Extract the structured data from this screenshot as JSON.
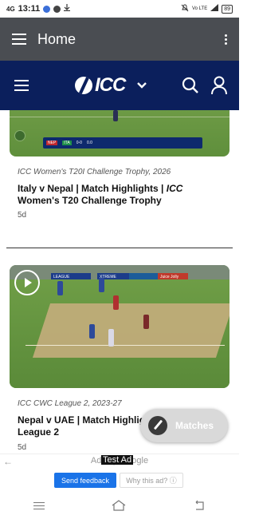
{
  "status_bar": {
    "network": "4G",
    "time": "13:11",
    "network_right": "Vo LTE",
    "battery": "89"
  },
  "app_bar": {
    "title": "Home",
    "menu_icon": "hamburger-icon",
    "overflow_icon": "more-vert-icon"
  },
  "site_header": {
    "logo_text": "ICC",
    "icons": [
      "menu-icon",
      "chevron-down-icon",
      "search-icon",
      "user-icon"
    ]
  },
  "scoreboard": {
    "team1": "NEP",
    "team2": "ITA",
    "score": "0-0",
    "over": "0.0"
  },
  "articles": [
    {
      "meta_prefix": "ICC",
      "meta": "Women's T20I Challenge Trophy, 2026",
      "title_part1": "Italy v Nepal | Match Highlights | ",
      "title_em": "ICC",
      "title_part2": " Women's T20 Challenge Trophy",
      "age": "5d"
    },
    {
      "meta_prefix": "ICC",
      "meta": "CWC League 2, 2023-27",
      "title": "Nepal v UAE | Match Highlights | ICC CWC League 2",
      "age": "5d",
      "boards": [
        "LEAGUE",
        "XTREME",
        "",
        "Juice Jolly"
      ]
    }
  ],
  "fab": {
    "label": "Matches",
    "icon": "cricket-bat-icon"
  },
  "ad": {
    "back_icon": "arrow-left-icon",
    "line": "Ads by Google",
    "test_label": "Test Ad",
    "feedback_label": "Send feedback",
    "why_label": "Why this ad? ⓘ",
    "colors": {
      "feedback": "#1a73e8"
    }
  },
  "nav": {
    "icons": [
      "recent-apps-icon",
      "home-icon",
      "back-icon"
    ]
  },
  "colors": {
    "app_bar": "#4a4d52",
    "icc_header": "#0b1f5c",
    "fab": "#d9d9d9"
  }
}
